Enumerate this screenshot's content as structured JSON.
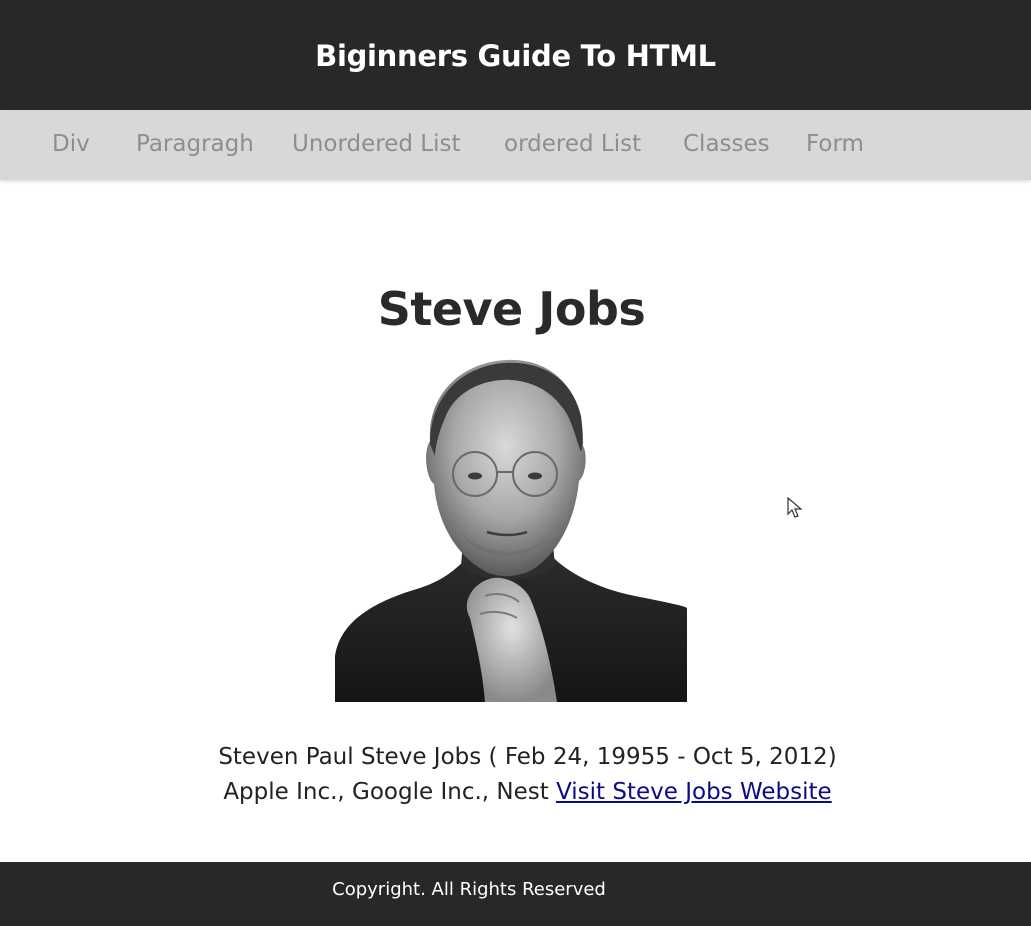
{
  "header": {
    "title": "Biginners Guide To HTML"
  },
  "nav": {
    "items": [
      {
        "label": "Div"
      },
      {
        "label": "Paragragh"
      },
      {
        "label": "Unordered List"
      },
      {
        "label": "ordered List"
      },
      {
        "label": "Classes"
      },
      {
        "label": "Form"
      }
    ]
  },
  "main": {
    "title": "Steve Jobs",
    "portrait_icon": "portrait-photo",
    "bio_line1": "Steven Paul Steve Jobs ( Feb 24, 19955 - Oct 5, 2012)",
    "bio_line2": "Apple Inc., Google Inc., Nest ",
    "link_text": "Visit Steve Jobs Website"
  },
  "footer": {
    "copyright": "Copyright. All Rights Reserved"
  },
  "colors": {
    "header_bg": "#282828",
    "nav_bg": "#d8d8d8",
    "nav_text": "#8e8e8e",
    "link": "#0a0a8a",
    "footer_bg": "#282828"
  }
}
